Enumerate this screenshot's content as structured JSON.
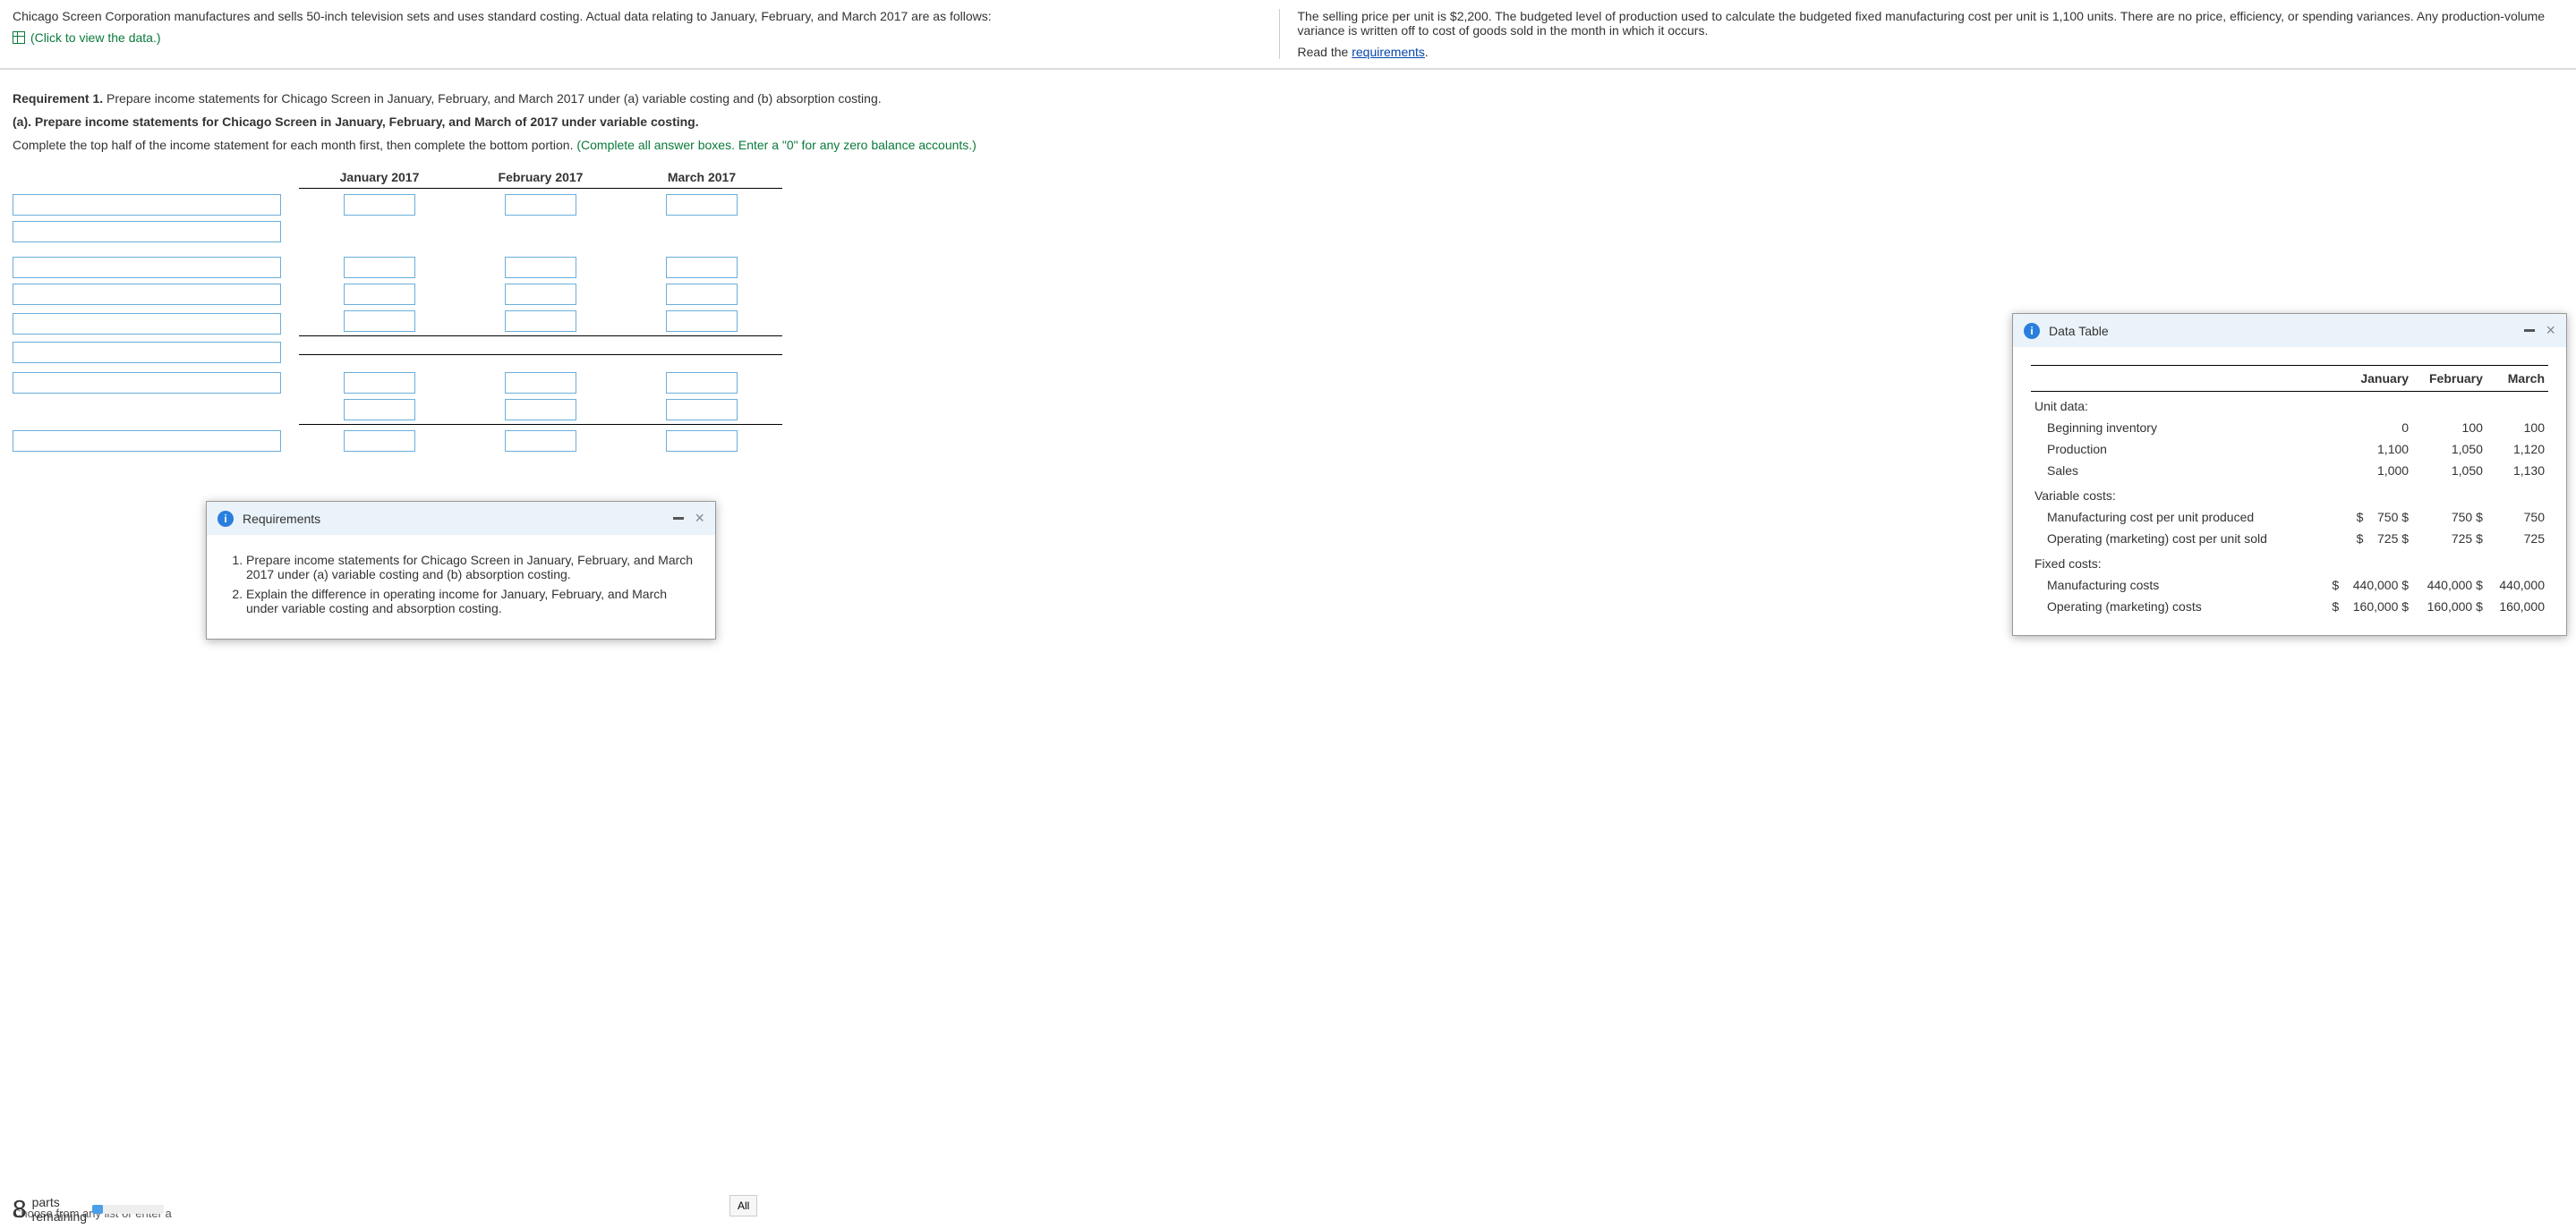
{
  "topLeft": "Chicago Screen Corporation manufactures and sells 50-inch television sets and uses standard costing. Actual data relating to January, February, and March 2017 are as follows:",
  "dataLinkText": "(Click to view the data.)",
  "topRight": "The selling price per unit is $2,200. The budgeted level of production used to calculate the budgeted fixed manufacturing cost per unit is 1,100 units. There are no price, efficiency, or spending variances. Any production-volume variance is written off to cost of goods sold in the month in which it occurs.",
  "readThe": "Read the ",
  "reqsLink": "requirements",
  "req1Label": "Requirement 1.",
  "req1Text": " Prepare income statements for Chicago Screen in January, February, and March 2017 under (a) variable costing and (b) absorption costing.",
  "partA": "(a). Prepare income statements for Chicago Screen in January, February, and March of 2017 under variable costing.",
  "instruction": "Complete the top half of the income statement for each month first, then complete the bottom portion. ",
  "greenHint": "(Complete all answer boxes. Enter a \"0\" for any zero balance accounts.)",
  "periods": [
    "January 2017",
    "February 2017",
    "March 2017"
  ],
  "reqsPopup": {
    "title": "Requirements",
    "items": [
      "Prepare income statements for Chicago Screen in January, February, and March 2017 under (a) variable costing and (b) absorption costing.",
      "Explain the difference in operating income for January, February, and March under variable costing and absorption costing."
    ]
  },
  "dataPopup": {
    "title": "Data Table",
    "cols": [
      "",
      "January",
      "February",
      "March"
    ]
  },
  "chart_data": {
    "type": "table",
    "title": "Data Table",
    "columns": [
      "",
      "January",
      "February",
      "March"
    ],
    "sections": [
      {
        "label": "Unit data:",
        "rows": [
          {
            "label": "Beginning inventory",
            "values": [
              0,
              100,
              100
            ]
          },
          {
            "label": "Production",
            "values": [
              1100,
              1050,
              1120
            ]
          },
          {
            "label": "Sales",
            "values": [
              1000,
              1050,
              1130
            ]
          }
        ]
      },
      {
        "label": "Variable costs:",
        "rows": [
          {
            "label": "Manufacturing cost per unit produced",
            "prefix": "$",
            "values": [
              750,
              750,
              750
            ]
          },
          {
            "label": "Operating (marketing) cost per unit sold",
            "prefix": "$",
            "values": [
              725,
              725,
              725
            ]
          }
        ]
      },
      {
        "label": "Fixed costs:",
        "rows": [
          {
            "label": "Manufacturing costs",
            "prefix": "$",
            "values": [
              440000,
              440000,
              440000
            ]
          },
          {
            "label": "Operating (marketing) costs",
            "prefix": "$",
            "values": [
              160000,
              160000,
              160000
            ]
          }
        ]
      }
    ]
  },
  "footer": {
    "choose": "Choose from any list or enter a",
    "partsNum": "8",
    "partsLabel": "parts",
    "remaining": "remaining",
    "allBtn": "All"
  }
}
